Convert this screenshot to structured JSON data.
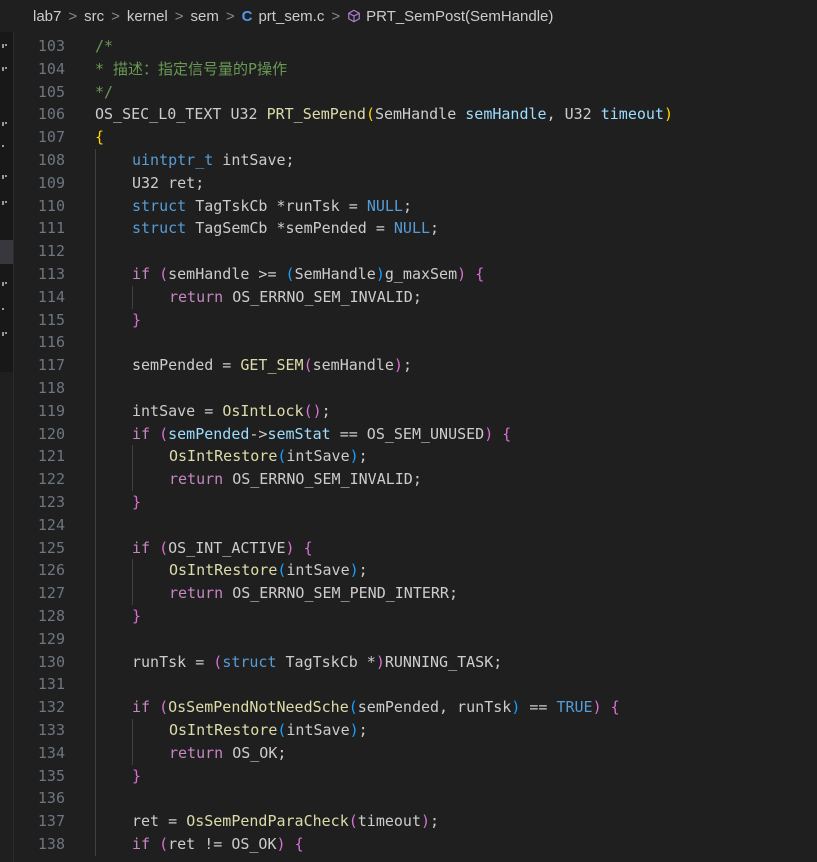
{
  "breadcrumb": {
    "items": [
      "lab7",
      "src",
      "kernel",
      "sem"
    ],
    "file": "prt_sem.c",
    "file_icon": "C",
    "symbol": "PRT_SemPost(SemHandle)",
    "separator": ">"
  },
  "editor": {
    "lines": [
      {
        "n": "103",
        "indent": 0,
        "tokens": [
          [
            "/*",
            "cm"
          ]
        ]
      },
      {
        "n": "104",
        "indent": 0,
        "tokens": [
          [
            "* 描述：指定信号量的P操作",
            "cm"
          ]
        ]
      },
      {
        "n": "105",
        "indent": 0,
        "tokens": [
          [
            "*/",
            "cm"
          ]
        ]
      },
      {
        "n": "106",
        "indent": 0,
        "tokens": [
          [
            "OS_SEC_L0_TEXT U32 ",
            "mac"
          ],
          [
            "PRT_SemPend",
            "fn"
          ],
          [
            "(",
            "b1"
          ],
          [
            "SemHandle ",
            "plain"
          ],
          [
            "semHandle",
            "var"
          ],
          [
            ", U32 ",
            "plain"
          ],
          [
            "timeout",
            "var"
          ],
          [
            ")",
            "b1"
          ]
        ]
      },
      {
        "n": "107",
        "indent": 0,
        "tokens": [
          [
            "{",
            "b1"
          ]
        ]
      },
      {
        "n": "108",
        "indent": 1,
        "tokens": [
          [
            "uintptr_t",
            "kw"
          ],
          [
            " intSave;",
            "plain"
          ]
        ]
      },
      {
        "n": "109",
        "indent": 1,
        "tokens": [
          [
            "U32 ret;",
            "plain"
          ]
        ]
      },
      {
        "n": "110",
        "indent": 1,
        "tokens": [
          [
            "struct",
            "kw"
          ],
          [
            " TagTskCb *runTsk = ",
            "plain"
          ],
          [
            "NULL",
            "kw"
          ],
          [
            ";",
            "plain"
          ]
        ]
      },
      {
        "n": "111",
        "indent": 1,
        "tokens": [
          [
            "struct",
            "kw"
          ],
          [
            " TagSemCb *semPended = ",
            "plain"
          ],
          [
            "NULL",
            "kw"
          ],
          [
            ";",
            "plain"
          ]
        ]
      },
      {
        "n": "112",
        "indent": 1,
        "tokens": []
      },
      {
        "n": "113",
        "indent": 1,
        "tokens": [
          [
            "if",
            "ctl"
          ],
          [
            " ",
            "plain"
          ],
          [
            "(",
            "b2"
          ],
          [
            "semHandle >= ",
            "plain"
          ],
          [
            "(",
            "b3"
          ],
          [
            "SemHandle",
            "plain"
          ],
          [
            ")",
            "b3"
          ],
          [
            "g_maxSem",
            "plain"
          ],
          [
            ")",
            "b2"
          ],
          [
            " ",
            "plain"
          ],
          [
            "{",
            "b2"
          ]
        ]
      },
      {
        "n": "114",
        "indent": 2,
        "tokens": [
          [
            "return",
            "ctl"
          ],
          [
            " OS_ERRNO_SEM_INVALID;",
            "plain"
          ]
        ]
      },
      {
        "n": "115",
        "indent": 1,
        "tokens": [
          [
            "}",
            "b2"
          ]
        ]
      },
      {
        "n": "116",
        "indent": 1,
        "tokens": []
      },
      {
        "n": "117",
        "indent": 1,
        "tokens": [
          [
            "semPended = ",
            "plain"
          ],
          [
            "GET_SEM",
            "fn"
          ],
          [
            "(",
            "b2"
          ],
          [
            "semHandle",
            "plain"
          ],
          [
            ")",
            "b2"
          ],
          [
            ";",
            "plain"
          ]
        ]
      },
      {
        "n": "118",
        "indent": 1,
        "tokens": []
      },
      {
        "n": "119",
        "indent": 1,
        "tokens": [
          [
            "intSave = ",
            "plain"
          ],
          [
            "OsIntLock",
            "fn"
          ],
          [
            "()",
            "b2"
          ],
          [
            ";",
            "plain"
          ]
        ]
      },
      {
        "n": "120",
        "indent": 1,
        "tokens": [
          [
            "if",
            "ctl"
          ],
          [
            " ",
            "plain"
          ],
          [
            "(",
            "b2"
          ],
          [
            "semPended",
            "var"
          ],
          [
            "->",
            "plain"
          ],
          [
            "semStat",
            "var"
          ],
          [
            " == OS_SEM_UNUSED",
            "plain"
          ],
          [
            ")",
            "b2"
          ],
          [
            " ",
            "plain"
          ],
          [
            "{",
            "b2"
          ]
        ]
      },
      {
        "n": "121",
        "indent": 2,
        "tokens": [
          [
            "OsIntRestore",
            "fn"
          ],
          [
            "(",
            "b3"
          ],
          [
            "intSave",
            "plain"
          ],
          [
            ")",
            "b3"
          ],
          [
            ";",
            "plain"
          ]
        ]
      },
      {
        "n": "122",
        "indent": 2,
        "tokens": [
          [
            "return",
            "ctl"
          ],
          [
            " OS_ERRNO_SEM_INVALID;",
            "plain"
          ]
        ]
      },
      {
        "n": "123",
        "indent": 1,
        "tokens": [
          [
            "}",
            "b2"
          ]
        ]
      },
      {
        "n": "124",
        "indent": 1,
        "tokens": []
      },
      {
        "n": "125",
        "indent": 1,
        "tokens": [
          [
            "if",
            "ctl"
          ],
          [
            " ",
            "plain"
          ],
          [
            "(",
            "b2"
          ],
          [
            "OS_INT_ACTIVE",
            "plain"
          ],
          [
            ")",
            "b2"
          ],
          [
            " ",
            "plain"
          ],
          [
            "{",
            "b2"
          ]
        ]
      },
      {
        "n": "126",
        "indent": 2,
        "tokens": [
          [
            "OsIntRestore",
            "fn"
          ],
          [
            "(",
            "b3"
          ],
          [
            "intSave",
            "plain"
          ],
          [
            ")",
            "b3"
          ],
          [
            ";",
            "plain"
          ]
        ]
      },
      {
        "n": "127",
        "indent": 2,
        "tokens": [
          [
            "return",
            "ctl"
          ],
          [
            " OS_ERRNO_SEM_PEND_INTERR;",
            "plain"
          ]
        ]
      },
      {
        "n": "128",
        "indent": 1,
        "tokens": [
          [
            "}",
            "b2"
          ]
        ]
      },
      {
        "n": "129",
        "indent": 1,
        "tokens": []
      },
      {
        "n": "130",
        "indent": 1,
        "tokens": [
          [
            "runTsk = ",
            "plain"
          ],
          [
            "(",
            "b2"
          ],
          [
            "struct",
            "kw"
          ],
          [
            " TagTskCb *",
            "plain"
          ],
          [
            ")",
            "b2"
          ],
          [
            "RUNNING_TASK;",
            "plain"
          ]
        ]
      },
      {
        "n": "131",
        "indent": 1,
        "tokens": []
      },
      {
        "n": "132",
        "indent": 1,
        "tokens": [
          [
            "if",
            "ctl"
          ],
          [
            " ",
            "plain"
          ],
          [
            "(",
            "b2"
          ],
          [
            "OsSemPendNotNeedSche",
            "fn"
          ],
          [
            "(",
            "b3"
          ],
          [
            "semPended, runTsk",
            "plain"
          ],
          [
            ")",
            "b3"
          ],
          [
            " == ",
            "plain"
          ],
          [
            "TRUE",
            "kw"
          ],
          [
            ")",
            "b2"
          ],
          [
            " ",
            "plain"
          ],
          [
            "{",
            "b2"
          ]
        ]
      },
      {
        "n": "133",
        "indent": 2,
        "tokens": [
          [
            "OsIntRestore",
            "fn"
          ],
          [
            "(",
            "b3"
          ],
          [
            "intSave",
            "plain"
          ],
          [
            ")",
            "b3"
          ],
          [
            ";",
            "plain"
          ]
        ]
      },
      {
        "n": "134",
        "indent": 2,
        "tokens": [
          [
            "return",
            "ctl"
          ],
          [
            " OS_OK;",
            "plain"
          ]
        ]
      },
      {
        "n": "135",
        "indent": 1,
        "tokens": [
          [
            "}",
            "b2"
          ]
        ]
      },
      {
        "n": "136",
        "indent": 1,
        "tokens": []
      },
      {
        "n": "137",
        "indent": 1,
        "tokens": [
          [
            "ret = ",
            "plain"
          ],
          [
            "OsSemPendParaCheck",
            "fn"
          ],
          [
            "(",
            "b2"
          ],
          [
            "timeout",
            "plain"
          ],
          [
            ")",
            "b2"
          ],
          [
            ";",
            "plain"
          ]
        ]
      },
      {
        "n": "138",
        "indent": 1,
        "tokens": [
          [
            "if",
            "ctl"
          ],
          [
            " ",
            "plain"
          ],
          [
            "(",
            "b2"
          ],
          [
            "ret != OS_OK",
            "plain"
          ],
          [
            ")",
            "b2"
          ],
          [
            " ",
            "plain"
          ],
          [
            "{",
            "b2"
          ]
        ]
      }
    ]
  }
}
